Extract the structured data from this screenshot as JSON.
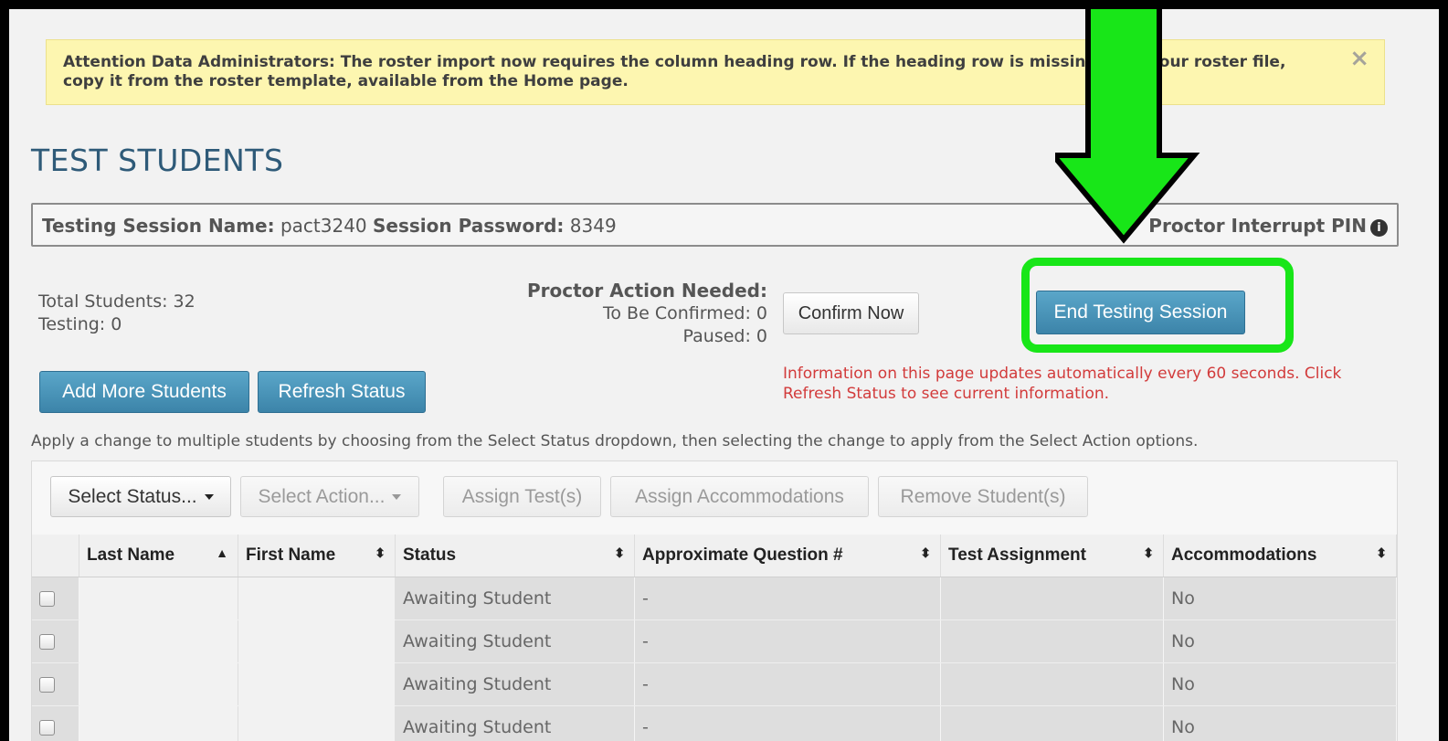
{
  "banner": {
    "text": "Attention Data Administrators: The roster import now requires the column heading row. If the heading row is missing from your roster file, copy it from the roster template, available from the Home page.",
    "close": "×"
  },
  "page": {
    "title": "TEST STUDENTS"
  },
  "session": {
    "name_label": "Testing Session Name:",
    "name_value": "pact3240",
    "password_label": "Session Password:",
    "password_value": "8349",
    "pin_label": "Proctor Interrupt PIN",
    "pin_icon": "info-icon"
  },
  "counts": {
    "total": "Total Students: 32",
    "testing": "Testing: 0"
  },
  "proctor": {
    "heading": "Proctor Action Needed:",
    "to_be_confirmed": "To Be Confirmed: 0",
    "paused": "Paused: 0"
  },
  "buttons": {
    "confirm_now": "Confirm Now",
    "end_session": "End Testing Session",
    "add_students": "Add More Students",
    "refresh_status": "Refresh Status"
  },
  "notice": "Information on this page updates automatically every 60 seconds. Click Refresh Status to see current information.",
  "help_text": "Apply a change to multiple students by choosing from the Select Status dropdown, then selecting the change to apply from the Select Action options.",
  "toolbar": {
    "select_status": "Select Status...",
    "select_action": "Select Action...",
    "assign_tests": "Assign Test(s)",
    "assign_accommodations": "Assign Accommodations",
    "remove_students": "Remove Student(s)"
  },
  "table": {
    "columns": [
      "Last Name",
      "First Name",
      "Status",
      "Approximate Question #",
      "Test Assignment",
      "Accommodations"
    ],
    "rows": [
      {
        "status": "Awaiting Student",
        "question": "-",
        "accommodations": "No"
      },
      {
        "status": "Awaiting Student",
        "question": "-",
        "accommodations": "No"
      },
      {
        "status": "Awaiting Student",
        "question": "-",
        "accommodations": "No"
      },
      {
        "status": "Awaiting Student",
        "question": "-",
        "accommodations": "No"
      }
    ]
  },
  "colors": {
    "accent_blue": "#3c84a9",
    "title_blue": "#2e5a78",
    "notice_red": "#d23b3b",
    "highlight_green": "#18e618",
    "banner_yellow": "#fdf6b0"
  }
}
